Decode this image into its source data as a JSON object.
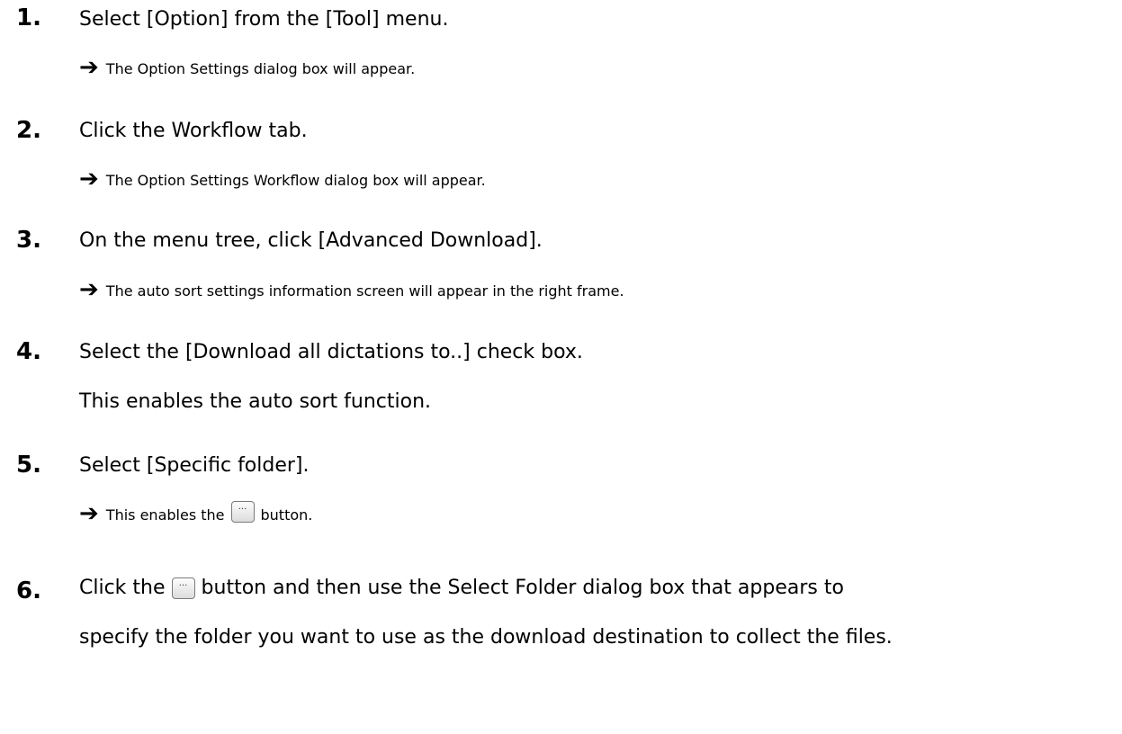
{
  "steps": [
    {
      "number": "1.",
      "text": "Select [Option] from the [Tool] menu.",
      "result": "The Option Settings dialog box will appear."
    },
    {
      "number": "2.",
      "text": "Click the Workflow tab.",
      "result": "The Option Settings Workflow dialog box will appear."
    },
    {
      "number": "3.",
      "text": "On the menu tree, click [Advanced Download].",
      "result": "The auto sort settings information screen will appear in the right frame."
    },
    {
      "number": "4.",
      "text": "Select the [Download all dictations to..] check box.",
      "note": "This enables the auto sort function."
    },
    {
      "number": "5.",
      "text": "Select [Specific folder].",
      "result_before": "This enables the",
      "result_after": "button."
    },
    {
      "number": "6.",
      "text_before": "Click the",
      "text_after": "button and then use the Select Folder dialog box that appears to",
      "text_line2": "specify the folder you want to use as the download destination to collect the files."
    }
  ],
  "icons": {
    "arrow": "right-arrow-icon",
    "browse_button": "ellipsis-button-icon",
    "arrow_glyph": "➔",
    "ellipsis_glyph": "···"
  }
}
